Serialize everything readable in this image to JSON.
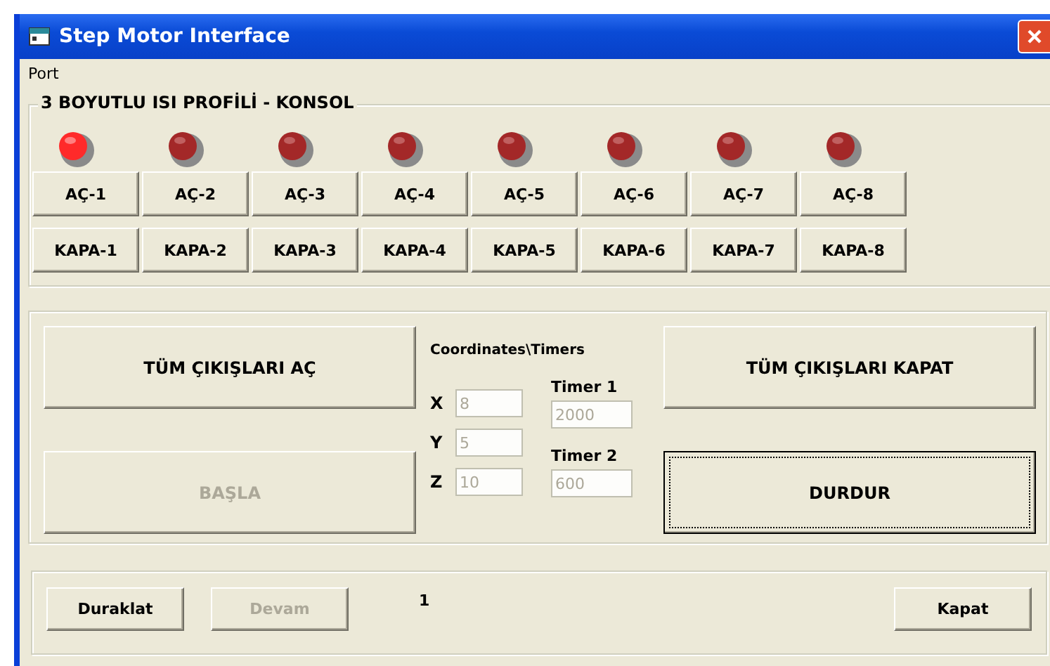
{
  "window": {
    "title": "Step Motor Interface"
  },
  "menu": [
    {
      "label": "Port"
    }
  ],
  "console": {
    "title": "3 BOYUTLU ISI PROFİLİ - KONSOL",
    "leds": [
      {
        "on": true
      },
      {
        "on": false
      },
      {
        "on": false
      },
      {
        "on": false
      },
      {
        "on": false
      },
      {
        "on": false
      },
      {
        "on": false
      },
      {
        "on": false
      }
    ],
    "open_buttons": [
      "AÇ-1",
      "AÇ-2",
      "AÇ-3",
      "AÇ-4",
      "AÇ-5",
      "AÇ-6",
      "AÇ-7",
      "AÇ-8"
    ],
    "close_buttons": [
      "KAPA-1",
      "KAPA-2",
      "KAPA-3",
      "KAPA-4",
      "KAPA-5",
      "KAPA-6",
      "KAPA-7",
      "KAPA-8"
    ]
  },
  "controls": {
    "open_all": {
      "label": "TÜM ÇIKIŞLARI AÇ",
      "disabled": false,
      "focused": false
    },
    "start": {
      "label": "BAŞLA",
      "disabled": true,
      "focused": false
    },
    "heading": "Coordinates\\Timers",
    "coordinates": [
      {
        "label": "X",
        "value": "8",
        "disabled": true
      },
      {
        "label": "Y",
        "value": "5",
        "disabled": true
      },
      {
        "label": "Z",
        "value": "10",
        "disabled": true
      }
    ],
    "timers": [
      {
        "label": "Timer 1",
        "value": "2000",
        "disabled": true
      },
      {
        "label": "Timer 2",
        "value": "600",
        "disabled": true
      }
    ],
    "close_all": {
      "label": "TÜM ÇIKIŞLARI KAPAT",
      "disabled": false,
      "focused": false
    },
    "stop": {
      "label": "DURDUR",
      "disabled": false,
      "focused": true
    }
  },
  "footer": {
    "pause": {
      "label": "Duraklat",
      "disabled": false
    },
    "resume": {
      "label": "Devam",
      "disabled": true
    },
    "counter": "1",
    "close": {
      "label": "Kapat",
      "disabled": false
    }
  }
}
